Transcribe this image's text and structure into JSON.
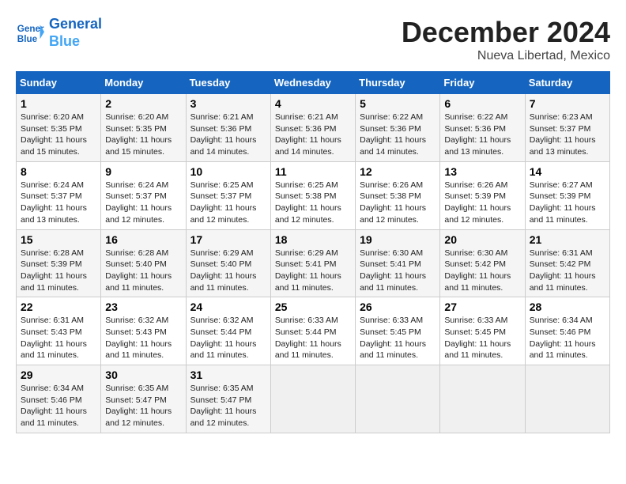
{
  "header": {
    "logo_line1": "General",
    "logo_line2": "Blue",
    "title": "December 2024",
    "subtitle": "Nueva Libertad, Mexico"
  },
  "weekdays": [
    "Sunday",
    "Monday",
    "Tuesday",
    "Wednesday",
    "Thursday",
    "Friday",
    "Saturday"
  ],
  "weeks": [
    [
      {
        "day": 1,
        "info": "Sunrise: 6:20 AM\nSunset: 5:35 PM\nDaylight: 11 hours and 15 minutes."
      },
      {
        "day": 2,
        "info": "Sunrise: 6:20 AM\nSunset: 5:35 PM\nDaylight: 11 hours and 15 minutes."
      },
      {
        "day": 3,
        "info": "Sunrise: 6:21 AM\nSunset: 5:36 PM\nDaylight: 11 hours and 14 minutes."
      },
      {
        "day": 4,
        "info": "Sunrise: 6:21 AM\nSunset: 5:36 PM\nDaylight: 11 hours and 14 minutes."
      },
      {
        "day": 5,
        "info": "Sunrise: 6:22 AM\nSunset: 5:36 PM\nDaylight: 11 hours and 14 minutes."
      },
      {
        "day": 6,
        "info": "Sunrise: 6:22 AM\nSunset: 5:36 PM\nDaylight: 11 hours and 13 minutes."
      },
      {
        "day": 7,
        "info": "Sunrise: 6:23 AM\nSunset: 5:37 PM\nDaylight: 11 hours and 13 minutes."
      }
    ],
    [
      {
        "day": 8,
        "info": "Sunrise: 6:24 AM\nSunset: 5:37 PM\nDaylight: 11 hours and 13 minutes."
      },
      {
        "day": 9,
        "info": "Sunrise: 6:24 AM\nSunset: 5:37 PM\nDaylight: 11 hours and 12 minutes."
      },
      {
        "day": 10,
        "info": "Sunrise: 6:25 AM\nSunset: 5:37 PM\nDaylight: 11 hours and 12 minutes."
      },
      {
        "day": 11,
        "info": "Sunrise: 6:25 AM\nSunset: 5:38 PM\nDaylight: 11 hours and 12 minutes."
      },
      {
        "day": 12,
        "info": "Sunrise: 6:26 AM\nSunset: 5:38 PM\nDaylight: 11 hours and 12 minutes."
      },
      {
        "day": 13,
        "info": "Sunrise: 6:26 AM\nSunset: 5:39 PM\nDaylight: 11 hours and 12 minutes."
      },
      {
        "day": 14,
        "info": "Sunrise: 6:27 AM\nSunset: 5:39 PM\nDaylight: 11 hours and 11 minutes."
      }
    ],
    [
      {
        "day": 15,
        "info": "Sunrise: 6:28 AM\nSunset: 5:39 PM\nDaylight: 11 hours and 11 minutes."
      },
      {
        "day": 16,
        "info": "Sunrise: 6:28 AM\nSunset: 5:40 PM\nDaylight: 11 hours and 11 minutes."
      },
      {
        "day": 17,
        "info": "Sunrise: 6:29 AM\nSunset: 5:40 PM\nDaylight: 11 hours and 11 minutes."
      },
      {
        "day": 18,
        "info": "Sunrise: 6:29 AM\nSunset: 5:41 PM\nDaylight: 11 hours and 11 minutes."
      },
      {
        "day": 19,
        "info": "Sunrise: 6:30 AM\nSunset: 5:41 PM\nDaylight: 11 hours and 11 minutes."
      },
      {
        "day": 20,
        "info": "Sunrise: 6:30 AM\nSunset: 5:42 PM\nDaylight: 11 hours and 11 minutes."
      },
      {
        "day": 21,
        "info": "Sunrise: 6:31 AM\nSunset: 5:42 PM\nDaylight: 11 hours and 11 minutes."
      }
    ],
    [
      {
        "day": 22,
        "info": "Sunrise: 6:31 AM\nSunset: 5:43 PM\nDaylight: 11 hours and 11 minutes."
      },
      {
        "day": 23,
        "info": "Sunrise: 6:32 AM\nSunset: 5:43 PM\nDaylight: 11 hours and 11 minutes."
      },
      {
        "day": 24,
        "info": "Sunrise: 6:32 AM\nSunset: 5:44 PM\nDaylight: 11 hours and 11 minutes."
      },
      {
        "day": 25,
        "info": "Sunrise: 6:33 AM\nSunset: 5:44 PM\nDaylight: 11 hours and 11 minutes."
      },
      {
        "day": 26,
        "info": "Sunrise: 6:33 AM\nSunset: 5:45 PM\nDaylight: 11 hours and 11 minutes."
      },
      {
        "day": 27,
        "info": "Sunrise: 6:33 AM\nSunset: 5:45 PM\nDaylight: 11 hours and 11 minutes."
      },
      {
        "day": 28,
        "info": "Sunrise: 6:34 AM\nSunset: 5:46 PM\nDaylight: 11 hours and 11 minutes."
      }
    ],
    [
      {
        "day": 29,
        "info": "Sunrise: 6:34 AM\nSunset: 5:46 PM\nDaylight: 11 hours and 11 minutes."
      },
      {
        "day": 30,
        "info": "Sunrise: 6:35 AM\nSunset: 5:47 PM\nDaylight: 11 hours and 12 minutes."
      },
      {
        "day": 31,
        "info": "Sunrise: 6:35 AM\nSunset: 5:47 PM\nDaylight: 11 hours and 12 minutes."
      },
      null,
      null,
      null,
      null
    ]
  ]
}
